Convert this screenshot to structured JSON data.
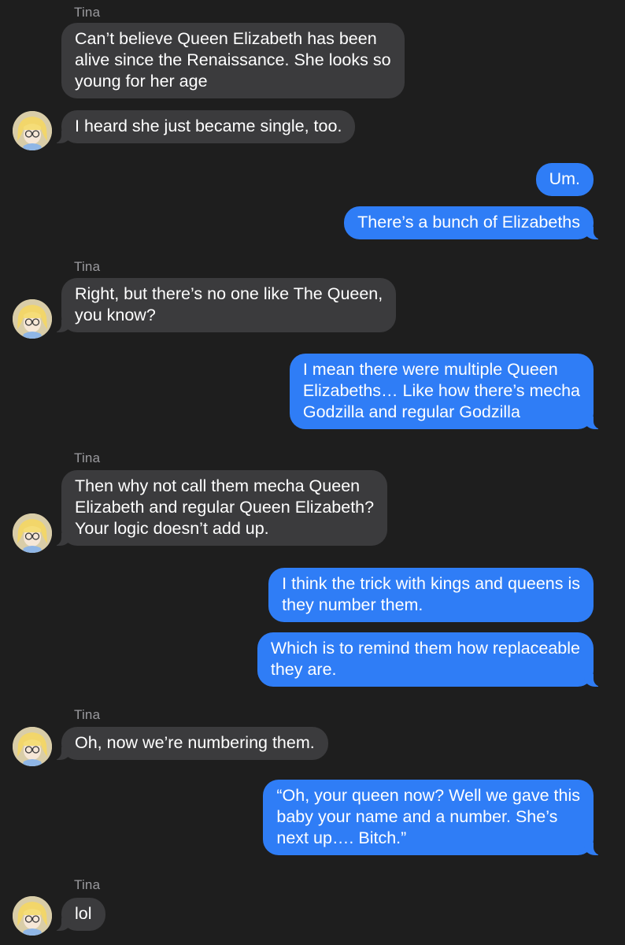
{
  "contact": {
    "name": "Tina"
  },
  "messages": [
    {
      "from": "Tina",
      "text": "Can’t believe Queen Elizabeth has been\nalive since the Renaissance. She looks so\nyoung for her age"
    },
    {
      "from": "Tina",
      "text": "I heard she just became single, too."
    },
    {
      "from": "me",
      "text": "Um."
    },
    {
      "from": "me",
      "text": "There’s a bunch of Elizabeths"
    },
    {
      "from": "Tina",
      "text": "Right, but there’s no one like The Queen,\nyou know?"
    },
    {
      "from": "me",
      "text": "I mean there were multiple Queen\nElizabeths… Like how there’s mecha\nGodzilla and regular Godzilla"
    },
    {
      "from": "Tina",
      "text": "Then why not call them mecha Queen\nElizabeth and regular Queen Elizabeth?\nYour logic doesn’t add up."
    },
    {
      "from": "me",
      "text": "I think the trick with kings and queens is\nthey number them."
    },
    {
      "from": "me",
      "text": "Which is to remind them how replaceable\nthey are."
    },
    {
      "from": "Tina",
      "text": "Oh, now we’re numbering them."
    },
    {
      "from": "me",
      "text": "“Oh, your queen now? Well we gave this\nbaby your name and a number. She’s\nnext up…. Bitch.”"
    },
    {
      "from": "Tina",
      "text": "lol"
    }
  ],
  "colors": {
    "background": "#1e1e1e",
    "incoming_bubble": "#3b3b3d",
    "outgoing_bubble": "#2f7df6",
    "sender_name": "#9a9a9e",
    "text": "#ffffff"
  },
  "icons": {
    "avatar": "tina-avatar-icon"
  }
}
